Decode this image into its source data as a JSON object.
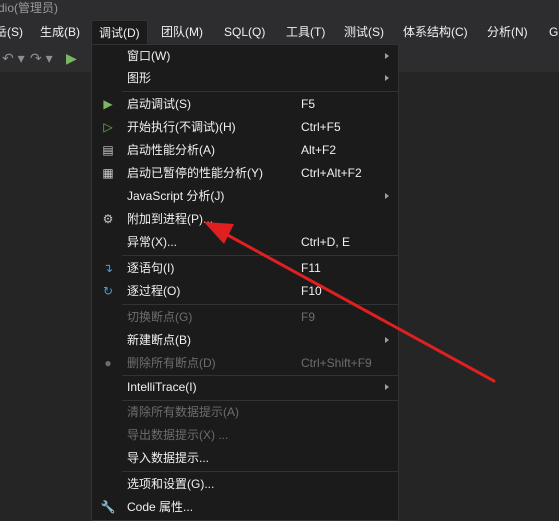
{
  "title": "dio(管理员)",
  "menubar": [
    {
      "label": "岳(S)"
    },
    {
      "label": "生成(B)"
    },
    {
      "label": "调试(D)"
    },
    {
      "label": "团队(M)"
    },
    {
      "label": "SQL(Q)"
    },
    {
      "label": "工具(T)"
    },
    {
      "label": "测试(S)"
    },
    {
      "label": "体系结构(C)"
    },
    {
      "label": "分析(N)"
    },
    {
      "label": "G"
    }
  ],
  "menu": [
    {
      "label": "窗口(W)"
    },
    {
      "label": "图形"
    },
    {
      "label": "启动调试(S)",
      "shortcut": "F5"
    },
    {
      "label": "开始执行(不调试)(H)",
      "shortcut": "Ctrl+F5"
    },
    {
      "label": "启动性能分析(A)",
      "shortcut": "Alt+F2"
    },
    {
      "label": "启动已暂停的性能分析(Y)",
      "shortcut": "Ctrl+Alt+F2"
    },
    {
      "label": "JavaScript 分析(J)"
    },
    {
      "label": "附加到进程(P)..."
    },
    {
      "label": "异常(X)...",
      "shortcut": "Ctrl+D, E"
    },
    {
      "label": "逐语句(I)",
      "shortcut": "F11"
    },
    {
      "label": "逐过程(O)",
      "shortcut": "F10"
    },
    {
      "label": "切换断点(G)",
      "shortcut": "F9"
    },
    {
      "label": "新建断点(B)"
    },
    {
      "label": "删除所有断点(D)",
      "shortcut": "Ctrl+Shift+F9"
    },
    {
      "label": "IntelliTrace(I)"
    },
    {
      "label": "清除所有数据提示(A)"
    },
    {
      "label": "导出数据提示(X) ..."
    },
    {
      "label": "导入数据提示..."
    },
    {
      "label": "选项和设置(G)..."
    },
    {
      "label": "Code 属性..."
    }
  ],
  "colors": {
    "accent": "#7bb661",
    "step": "#4a9cd6",
    "annotation": "#e02020"
  }
}
